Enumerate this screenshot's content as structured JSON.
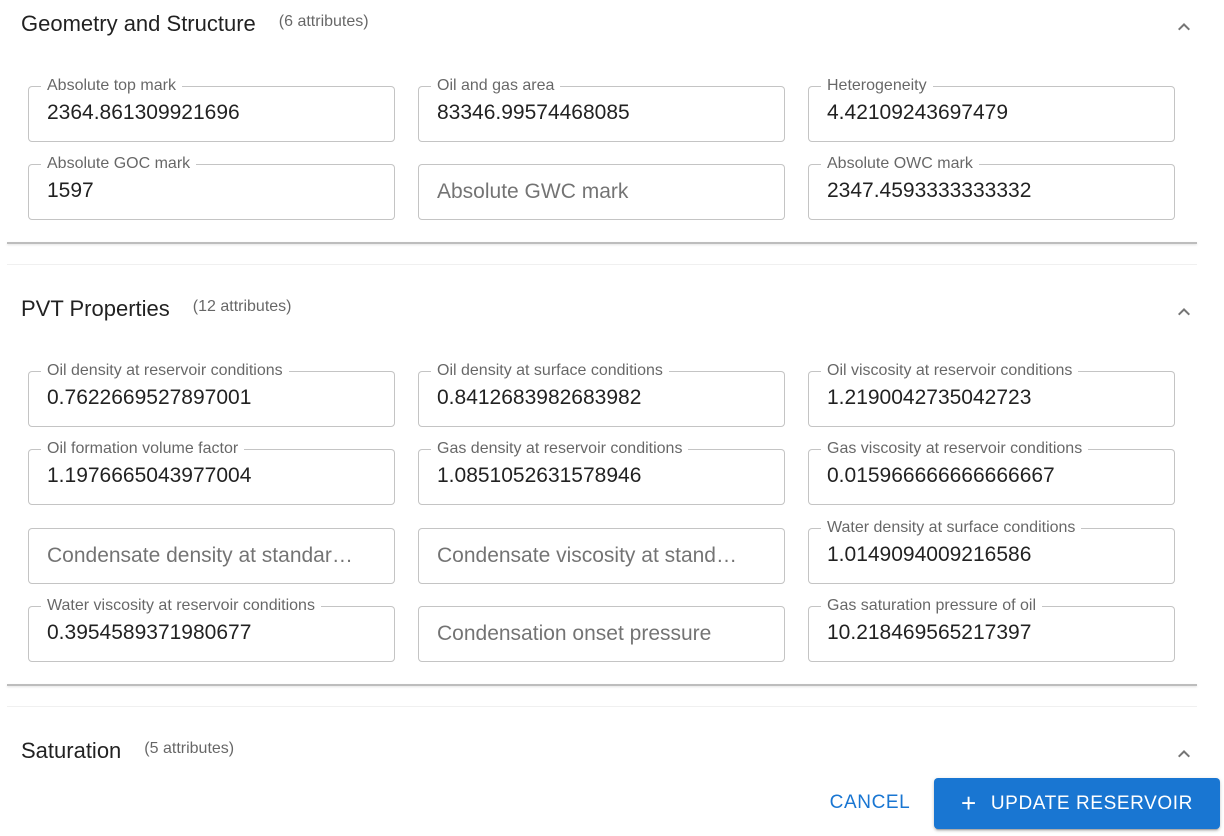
{
  "sections": [
    {
      "title": "Geometry and Structure",
      "count": "(6 attributes)",
      "fields": [
        {
          "label": "Absolute top mark",
          "value": "2364.861309921696",
          "placeholder": ""
        },
        {
          "label": "Oil and gas area",
          "value": "83346.99574468085",
          "placeholder": ""
        },
        {
          "label": "Heterogeneity",
          "value": "4.42109243697479",
          "placeholder": ""
        },
        {
          "label": "Absolute GOC mark",
          "value": "1597",
          "placeholder": ""
        },
        {
          "label": "",
          "value": "",
          "placeholder": "Absolute GWC mark"
        },
        {
          "label": "Absolute OWC mark",
          "value": "2347.4593333333332",
          "placeholder": ""
        }
      ]
    },
    {
      "title": "PVT Properties",
      "count": "(12 attributes)",
      "fields": [
        {
          "label": "Oil density at reservoir conditions",
          "value": "0.7622669527897001",
          "placeholder": ""
        },
        {
          "label": "Oil density at surface conditions",
          "value": "0.8412683982683982",
          "placeholder": ""
        },
        {
          "label": "Oil viscosity at reservoir conditions",
          "value": "1.2190042735042723",
          "placeholder": ""
        },
        {
          "label": "Oil formation volume factor",
          "value": "1.1976665043977004",
          "placeholder": ""
        },
        {
          "label": "Gas density at reservoir conditions",
          "value": "1.0851052631578946",
          "placeholder": ""
        },
        {
          "label": "Gas viscosity at reservoir conditions",
          "value": "0.015966666666666667",
          "placeholder": ""
        },
        {
          "label": "",
          "value": "",
          "placeholder": "Condensate density at standar…"
        },
        {
          "label": "",
          "value": "",
          "placeholder": "Condensate viscosity at stand…"
        },
        {
          "label": "Water density at surface conditions",
          "value": "1.0149094009216586",
          "placeholder": ""
        },
        {
          "label": "Water viscosity at reservoir conditions",
          "value": "0.3954589371980677",
          "placeholder": ""
        },
        {
          "label": "",
          "value": "",
          "placeholder": "Condensation onset pressure"
        },
        {
          "label": "Gas saturation pressure of oil",
          "value": "10.218469565217397",
          "placeholder": ""
        }
      ]
    },
    {
      "title": "Saturation",
      "count": "(5 attributes)",
      "fields": []
    }
  ],
  "actions": {
    "cancel_label": "CANCEL",
    "update_label": "UPDATE RESERVOIR",
    "update_icon": "plus-icon"
  },
  "colors": {
    "primary": "#1976d2",
    "outline": "#c4c4c4",
    "label": "#666666"
  }
}
